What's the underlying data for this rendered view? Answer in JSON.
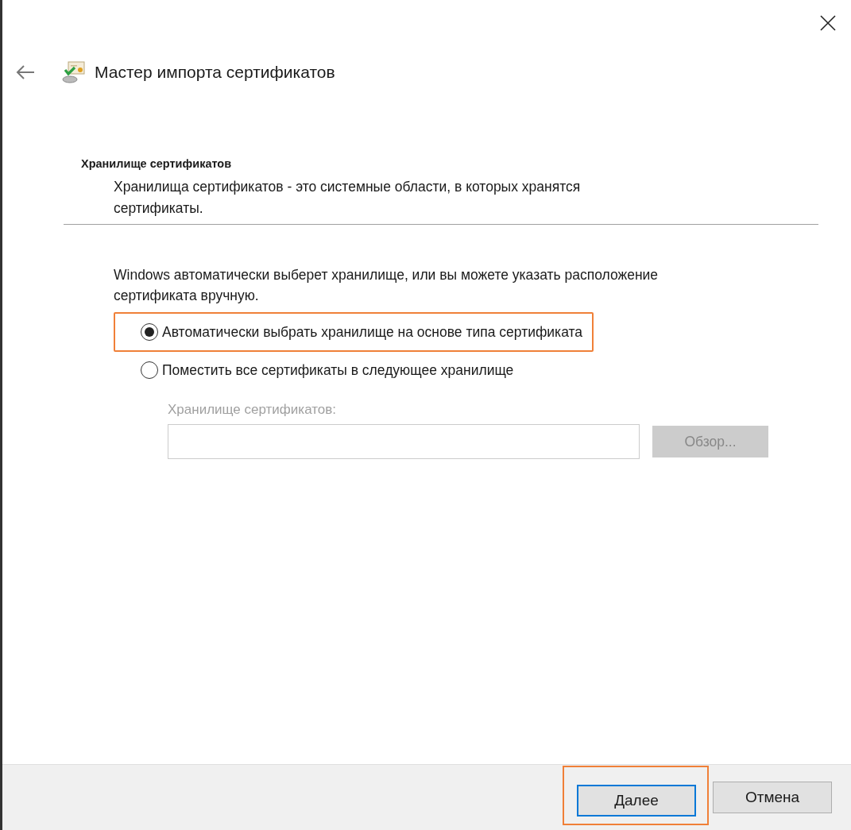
{
  "window": {
    "title": "Мастер импорта сертификатов"
  },
  "section": {
    "heading": "Хранилище сертификатов",
    "description": "Хранилища сертификатов - это системные области, в которых хранятся сертификаты."
  },
  "intro": "Windows автоматически выберет хранилище, или вы можете указать расположение сертификата вручную.",
  "options": [
    {
      "label": "Автоматически выбрать хранилище на основе типа сертификата",
      "selected": true,
      "highlighted": true
    },
    {
      "label": "Поместить все сертификаты в следующее хранилище",
      "selected": false,
      "highlighted": false
    }
  ],
  "store_field": {
    "label": "Хранилище сертификатов:",
    "disabled": true,
    "browse_button": "Обзор..."
  },
  "buttons": [
    {
      "label": "Далее",
      "default": true,
      "highlighted": true
    },
    {
      "label": "Отмена",
      "default": false,
      "highlighted": false
    }
  ]
}
